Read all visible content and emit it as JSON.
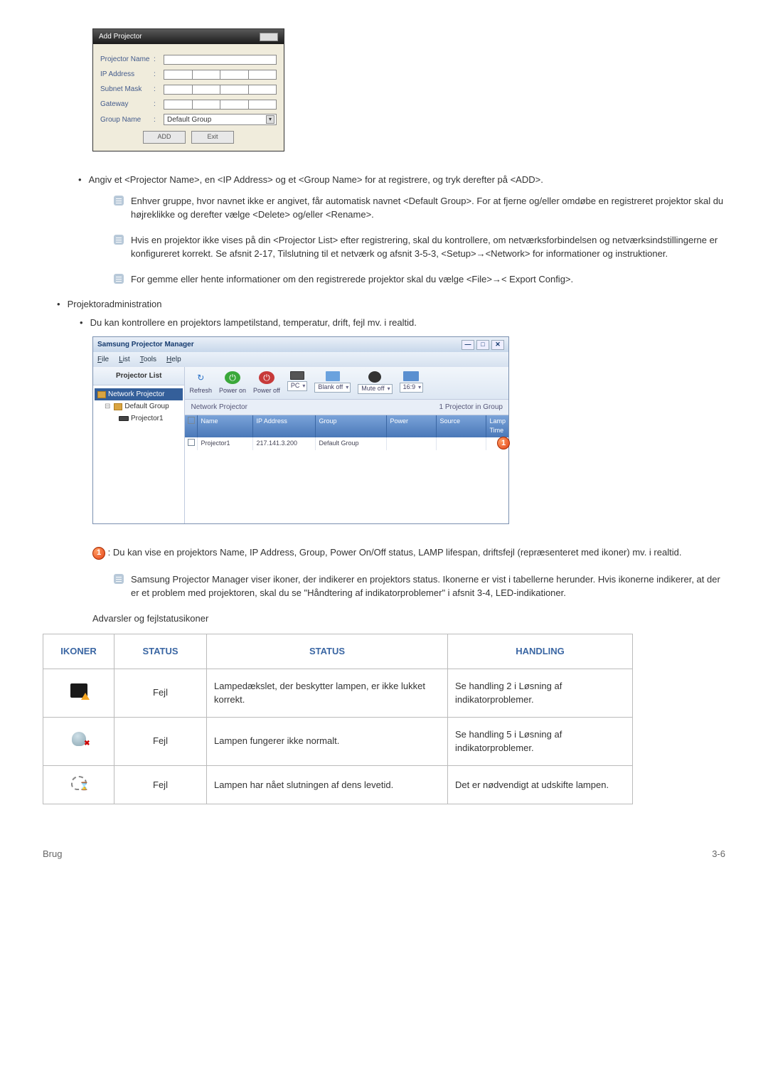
{
  "dialog": {
    "title": "Add Projector",
    "labels": {
      "name": "Projector Name",
      "ip": "IP Address",
      "subnet": "Subnet Mask",
      "gateway": "Gateway",
      "group": "Group Name"
    },
    "group_value": "Default Group",
    "add_btn": "ADD",
    "exit_btn": "Exit"
  },
  "instr1": "Angiv et <Projector Name>, en <IP Address> og et <Group Name> for at registrere, og tryk derefter på <ADD>.",
  "note1": "Enhver gruppe, hvor navnet ikke er angivet, får automatisk navnet <Default Group>. For at fjerne og/eller omdøbe en registreret projektor skal du højreklikke og derefter vælge <Delete> og/eller <Rename>.",
  "note2": "Hvis en projektor ikke vises på din <Projector List> efter registrering, skal du kontrollere, om netværksforbindelsen og netværksindstillingerne er konfigureret korrekt. Se afsnit 2-17, Tilslutning til et netværk og afsnit 3-5-3, <Setup>→<Network> for informationer og instruktioner.",
  "note3": "For gemme eller hente informationer om den registrerede projektor skal du vælge <File>→< Export Config>.",
  "section": "Projektoradministration",
  "section_sub": "Du kan kontrollere en projektors lampetilstand, temperatur, drift, fejl mv. i realtid.",
  "pm": {
    "title": "Samsung Projector Manager",
    "menus": [
      "File",
      "List",
      "Tools",
      "Help"
    ],
    "side_header": "Projector List",
    "tree": {
      "root": "Network Projector",
      "group": "Default Group",
      "proj": "Projector1"
    },
    "tools": {
      "refresh": "Refresh",
      "poweron": "Power on",
      "poweroff": "Power off",
      "pc": "PC",
      "blank": "Blank off",
      "mute": "Mute off",
      "aspect": "16:9"
    },
    "subleft": "Network Projector",
    "subright": "1 Projector in Group",
    "th": {
      "name": "Name",
      "ip": "IP Address",
      "group": "Group",
      "power": "Power",
      "source": "Source",
      "lamp": "Lamp Time"
    },
    "row": {
      "name": "Projector1",
      "ip": "217.141.3.200",
      "group": "Default Group"
    }
  },
  "callout_text": " : Du kan vise en projektors Name, IP Address, Group, Power On/Off status, LAMP lifespan, driftsfejl (repræsenteret med ikoner) mv. i realtid.",
  "note4": "Samsung Projector Manager viser ikoner, der indikerer en projektors status. Ikonerne er vist i tabellerne herunder. Hvis ikonerne indikerer, at der er et problem med projektoren, skal du se \"Håndtering af indikatorproblemer\" i afsnit 3-4, LED-indikationer.",
  "table_intro": "Advarsler og fejlstatusikoner",
  "table": {
    "headers": {
      "icons": "IKONER",
      "status1": "STATUS",
      "status2": "STATUS",
      "handling": "HANDLING"
    },
    "rows": [
      {
        "status": "Fejl",
        "desc": "Lampedækslet, der beskytter lampen, er ikke lukket korrekt.",
        "handling": "Se handling 2 i Løsning af indikatorproblemer."
      },
      {
        "status": "Fejl",
        "desc": "Lampen fungerer ikke normalt.",
        "handling": "Se handling 5 i Løsning af indikatorproblemer."
      },
      {
        "status": "Fejl",
        "desc": "Lampen har nået slutningen af dens levetid.",
        "handling": "Det er nødvendigt at udskifte lampen."
      }
    ]
  },
  "footer": {
    "left": "Brug",
    "right": "3-6"
  }
}
